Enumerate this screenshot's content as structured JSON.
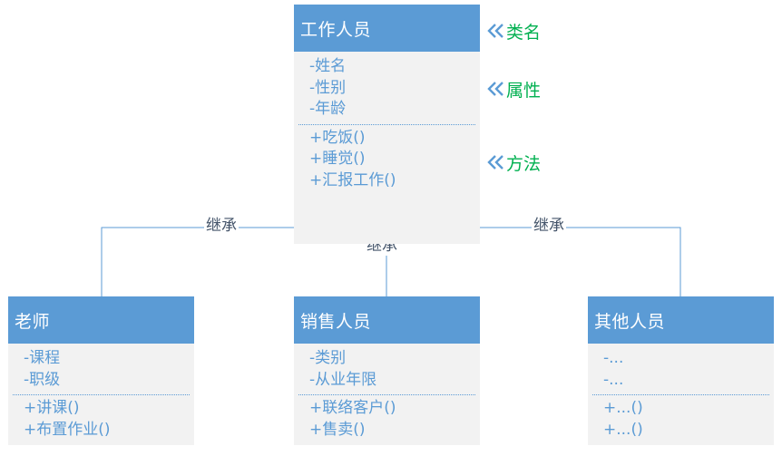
{
  "classes": {
    "staff": {
      "name": "工作人员",
      "attributes": [
        "-姓名",
        "-性别",
        "-年龄"
      ],
      "methods": [
        "+吃饭()",
        "+睡觉()",
        "+汇报工作()"
      ]
    },
    "teacher": {
      "name": "老师",
      "attributes": [
        "-课程",
        "-职级"
      ],
      "methods": [
        "+讲课()",
        "+布置作业()"
      ]
    },
    "sales": {
      "name": "销售人员",
      "attributes": [
        "-类别",
        "-从业年限"
      ],
      "methods": [
        "+联络客户()",
        "+售卖()"
      ]
    },
    "others": {
      "name": "其他人员",
      "attributes": [
        "-...",
        "-..."
      ],
      "methods": [
        "+...()",
        "+...()"
      ]
    }
  },
  "edges": {
    "teacher_label": "继承",
    "sales_label": "继承",
    "others_label": "继承"
  },
  "annotations": {
    "class_name": "类名",
    "attributes": "属性",
    "methods": "方法"
  },
  "colors": {
    "header_fill": "#5b9bd5",
    "header_text": "#ffffff",
    "body_fill": "#f2f2f2",
    "member_text": "#5b9bd5",
    "connector": "#5b9bd5",
    "edge_label_text": "#44546a",
    "annotation_text": "#00b050",
    "annotation_chevron": "#5b9bd5"
  }
}
